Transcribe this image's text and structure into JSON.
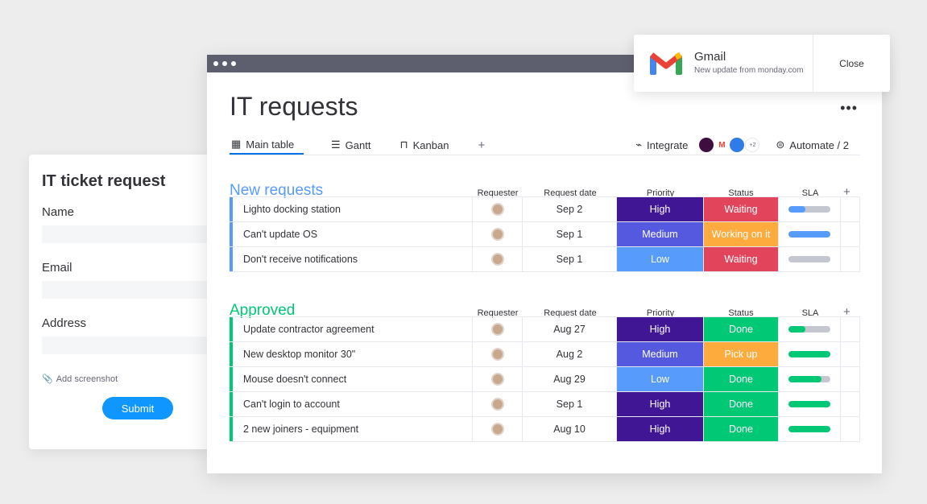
{
  "form": {
    "title": "IT ticket request",
    "fields": [
      "Name",
      "Email",
      "Address"
    ],
    "add_screenshot": "Add screenshot",
    "submit": "Submit"
  },
  "board": {
    "title": "IT requests",
    "tabs": [
      {
        "label": "Main table",
        "icon": "table-icon"
      },
      {
        "label": "Gantt",
        "icon": "gantt-icon"
      },
      {
        "label": "Kanban",
        "icon": "kanban-icon"
      }
    ],
    "add_tab": "+",
    "integrate": "Integrate",
    "integrations_more": "+2",
    "automate": "Automate / 2",
    "more": "•••"
  },
  "columns": [
    "Requester",
    "Request date",
    "Priority",
    "Status",
    "SLA"
  ],
  "add_column": "+",
  "colors": {
    "High": "#401694",
    "Medium": "#5559df",
    "Low": "#579bfc",
    "Waiting": "#e2445c",
    "Working on it": "#fdab3d",
    "Done": "#00c875",
    "Pick up": "#fdab3d"
  },
  "groups": [
    {
      "title": "New requests",
      "color": "#579bfc",
      "rows": [
        {
          "name": "Lighto docking station",
          "date": "Sep 2",
          "priority": "High",
          "status": "Waiting",
          "sla": 40
        },
        {
          "name": "Can't update OS",
          "date": "Sep 1",
          "priority": "Medium",
          "status": "Working on it",
          "sla": 100
        },
        {
          "name": "Don't receive notifications",
          "date": "Sep 1",
          "priority": "Low",
          "status": "Waiting",
          "sla": 0
        }
      ]
    },
    {
      "title": "Approved",
      "color": "#00c875",
      "rows": [
        {
          "name": "Update contractor agreement",
          "date": "Aug 27",
          "priority": "High",
          "status": "Done",
          "sla": 40
        },
        {
          "name": "New desktop monitor 30\"",
          "date": "Aug 2",
          "priority": "Medium",
          "status": "Pick up",
          "sla": 100
        },
        {
          "name": "Mouse doesn't connect",
          "date": "Aug 29",
          "priority": "Low",
          "status": "Done",
          "sla": 78
        },
        {
          "name": "Can't login to account",
          "date": "Sep 1",
          "priority": "High",
          "status": "Done",
          "sla": 100
        },
        {
          "name": "2 new joiners - equipment",
          "date": "Aug 10",
          "priority": "High",
          "status": "Done",
          "sla": 100
        }
      ]
    }
  ],
  "notification": {
    "app": "Gmail",
    "message": "New update from monday.com",
    "close": "Close"
  }
}
